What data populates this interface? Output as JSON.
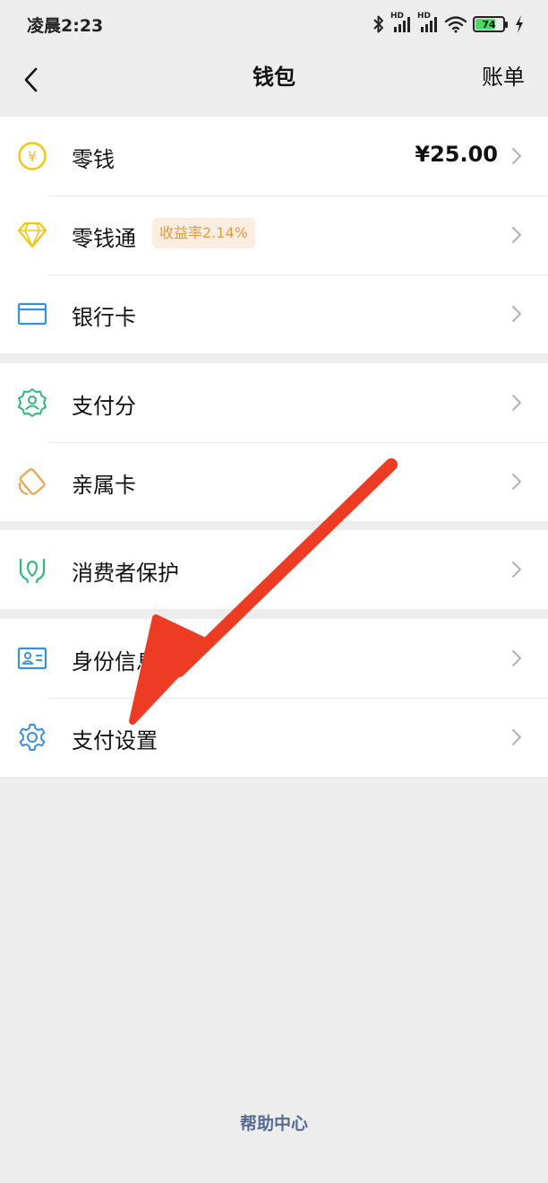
{
  "status_bar": {
    "time": "凌晨2:23",
    "network_1": "HD",
    "network_2": "HD",
    "battery": "74",
    "icons": [
      "bluetooth-icon",
      "signal-icon",
      "signal-icon",
      "wifi-icon",
      "battery-icon",
      "charging-icon"
    ]
  },
  "nav": {
    "title": "钱包",
    "right": "账单",
    "back_icon": "back-chevron-icon"
  },
  "groups": [
    {
      "items": [
        {
          "label": "零钱",
          "icon": "coin-yen-icon",
          "value": "¥25.00"
        },
        {
          "label": "零钱通",
          "icon": "diamond-icon",
          "badge": "收益率2.14%"
        },
        {
          "label": "银行卡",
          "icon": "bank-card-icon"
        }
      ]
    },
    {
      "items": [
        {
          "label": "支付分",
          "icon": "pay-score-badge-icon"
        },
        {
          "label": "亲属卡",
          "icon": "family-card-icon"
        }
      ]
    },
    {
      "items": [
        {
          "label": "消费者保护",
          "icon": "protective-hands-icon"
        }
      ]
    },
    {
      "items": [
        {
          "label": "身份信息",
          "icon": "id-card-icon"
        },
        {
          "label": "支付设置",
          "icon": "gear-icon"
        }
      ]
    }
  ],
  "footer": {
    "help": "帮助中心"
  },
  "colors": {
    "background": "#ededed",
    "card": "#ffffff",
    "coin_yellow": "#f5c518",
    "teal": "#2fb87a",
    "blue": "#3b8fd6",
    "orange": "#f0a24a",
    "link_blue": "#566c94",
    "annotation_arrow": "#ee3b24"
  }
}
